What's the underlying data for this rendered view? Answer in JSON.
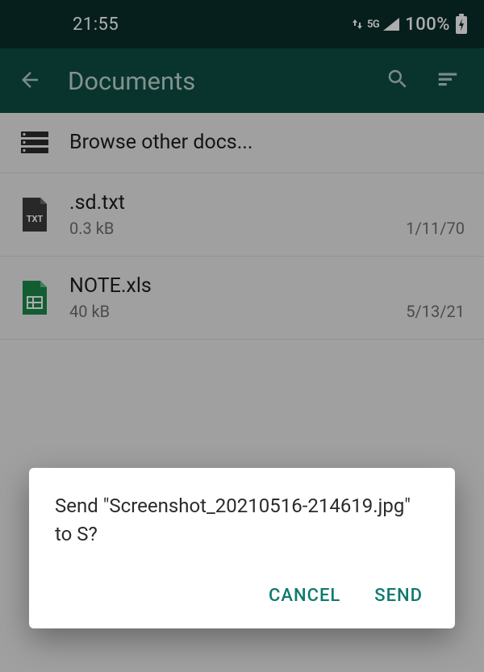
{
  "status": {
    "time": "21:55",
    "network": "5G",
    "battery_text": "100%"
  },
  "header": {
    "title": "Documents"
  },
  "list": {
    "browse_label": "Browse other docs...",
    "items": [
      {
        "name": ".sd.txt",
        "size": "0.3 kB",
        "date": "1/11/70",
        "type": "txt",
        "icon_badge": "TXT"
      },
      {
        "name": "NOTE.xls",
        "size": "40 kB",
        "date": "5/13/21",
        "type": "xls"
      }
    ]
  },
  "dialog": {
    "message": "Send \"Screenshot_20210516-214619.jpg\" to S?",
    "cancel": "CANCEL",
    "confirm": "SEND"
  },
  "colors": {
    "status_bg": "#0a2f2a",
    "appbar_bg": "#0e4d45",
    "accent": "#0e7a6e"
  }
}
